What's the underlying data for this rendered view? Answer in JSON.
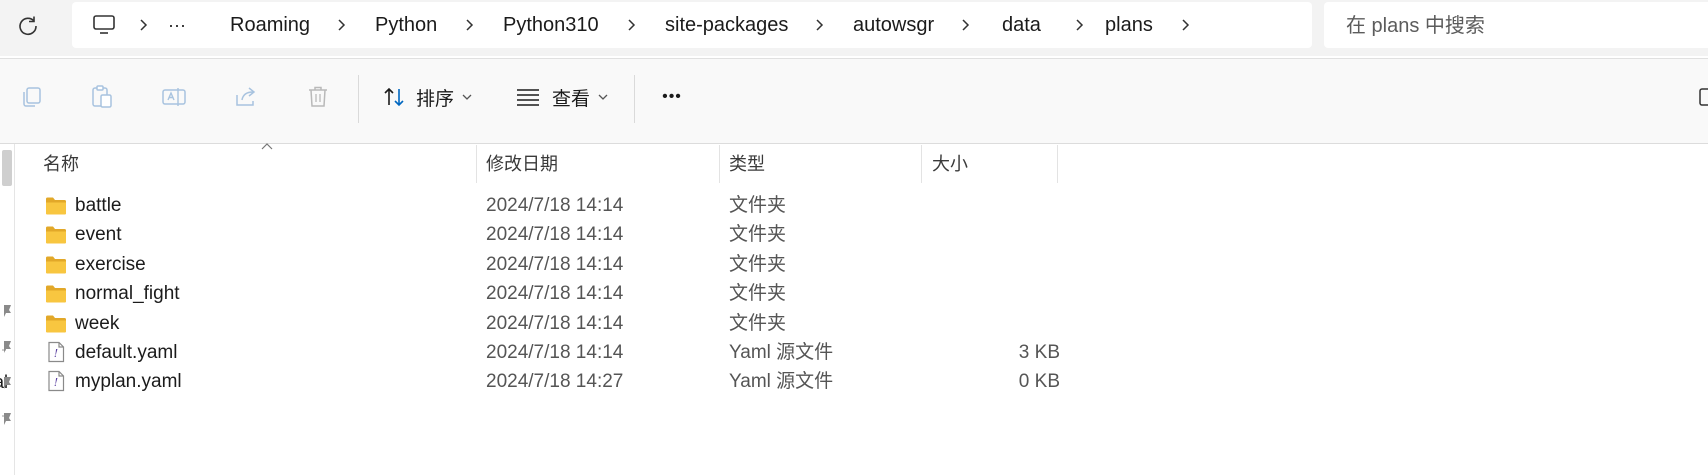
{
  "address_bar": {
    "crumbs": [
      "Roaming",
      "Python",
      "Python310",
      "site-packages",
      "autowsgr",
      "data",
      "plans"
    ],
    "overflow_label": "···"
  },
  "search": {
    "placeholder": "在 plans 中搜索"
  },
  "toolbar": {
    "sort_label": "排序",
    "view_label": "查看",
    "more_label": "•••"
  },
  "nav_pane": {
    "partial_text": "al"
  },
  "columns": {
    "name": "名称",
    "modified": "修改日期",
    "type": "类型",
    "size": "大小"
  },
  "files": [
    {
      "name": "battle",
      "modified": "2024/7/18 14:14",
      "type": "文件夹",
      "size": "",
      "icon": "folder-icon"
    },
    {
      "name": "event",
      "modified": "2024/7/18 14:14",
      "type": "文件夹",
      "size": "",
      "icon": "folder-icon"
    },
    {
      "name": "exercise",
      "modified": "2024/7/18 14:14",
      "type": "文件夹",
      "size": "",
      "icon": "folder-icon"
    },
    {
      "name": "normal_fight",
      "modified": "2024/7/18 14:14",
      "type": "文件夹",
      "size": "",
      "icon": "folder-icon"
    },
    {
      "name": "week",
      "modified": "2024/7/18 14:14",
      "type": "文件夹",
      "size": "",
      "icon": "folder-icon"
    },
    {
      "name": "default.yaml",
      "modified": "2024/7/18 14:14",
      "type": "Yaml 源文件",
      "size": "3 KB",
      "icon": "yaml-file-icon"
    },
    {
      "name": "myplan.yaml",
      "modified": "2024/7/18 14:27",
      "type": "Yaml 源文件",
      "size": "0 KB",
      "icon": "yaml-file-icon"
    }
  ],
  "colors": {
    "folder": "#f8c640",
    "folder_dark": "#e2a829",
    "accent": "#0067c0"
  }
}
